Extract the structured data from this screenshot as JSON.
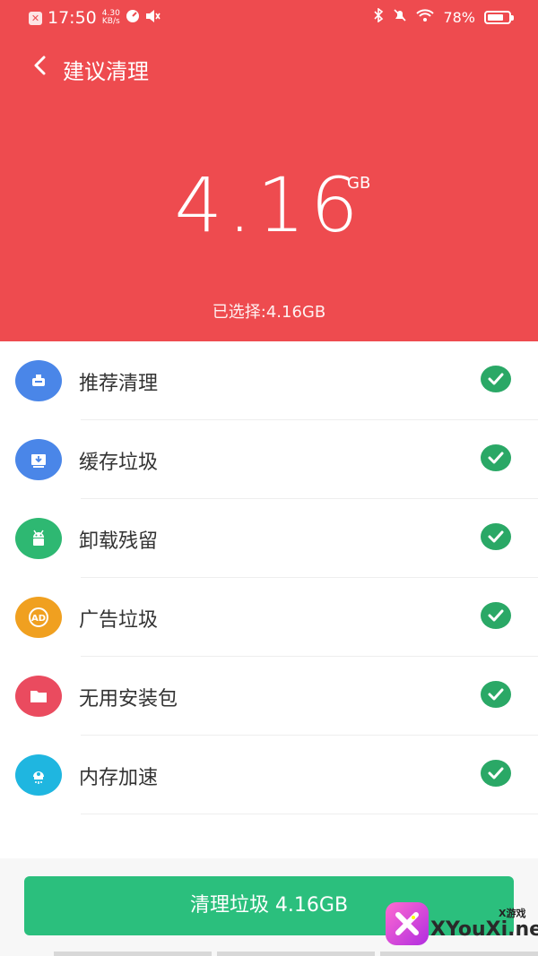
{
  "status_bar": {
    "time": "17:50",
    "net_speed_value": "4.30",
    "net_speed_unit": "KB/s",
    "battery": "78%",
    "battery_level": 0.78,
    "icons": [
      "notification-x-icon",
      "gauge-icon",
      "volume-icon",
      "bluetooth-icon",
      "alarm-off-icon",
      "wifi-icon",
      "battery-icon"
    ]
  },
  "header": {
    "back_icon": "chevron-left-icon",
    "title": "建议清理",
    "size_value": "4.16",
    "size_unit": "GB",
    "selected_text": "已选择:4.16GB",
    "background_color": "#ee4b4f"
  },
  "items": [
    {
      "label": "推荐清理",
      "icon": "broom-icon",
      "color": "#4a86e8",
      "checked": true
    },
    {
      "label": "缓存垃圾",
      "icon": "download-tray-icon",
      "color": "#4a86e8",
      "checked": true
    },
    {
      "label": "卸载残留",
      "icon": "android-icon",
      "color": "#2eb872",
      "checked": true
    },
    {
      "label": "广告垃圾",
      "icon": "ad-icon",
      "color": "#f0a020",
      "checked": true
    },
    {
      "label": "无用安装包",
      "icon": "folder-icon",
      "color": "#ea4b5f",
      "checked": true
    },
    {
      "label": "内存加速",
      "icon": "rocket-icon",
      "color": "#1fb6e0",
      "checked": true
    }
  ],
  "action": {
    "clean_label": "清理垃圾 4.16GB",
    "color": "#2bbf7d"
  },
  "watermark": {
    "text": "XYouXi.net",
    "tag": "X游戏"
  }
}
